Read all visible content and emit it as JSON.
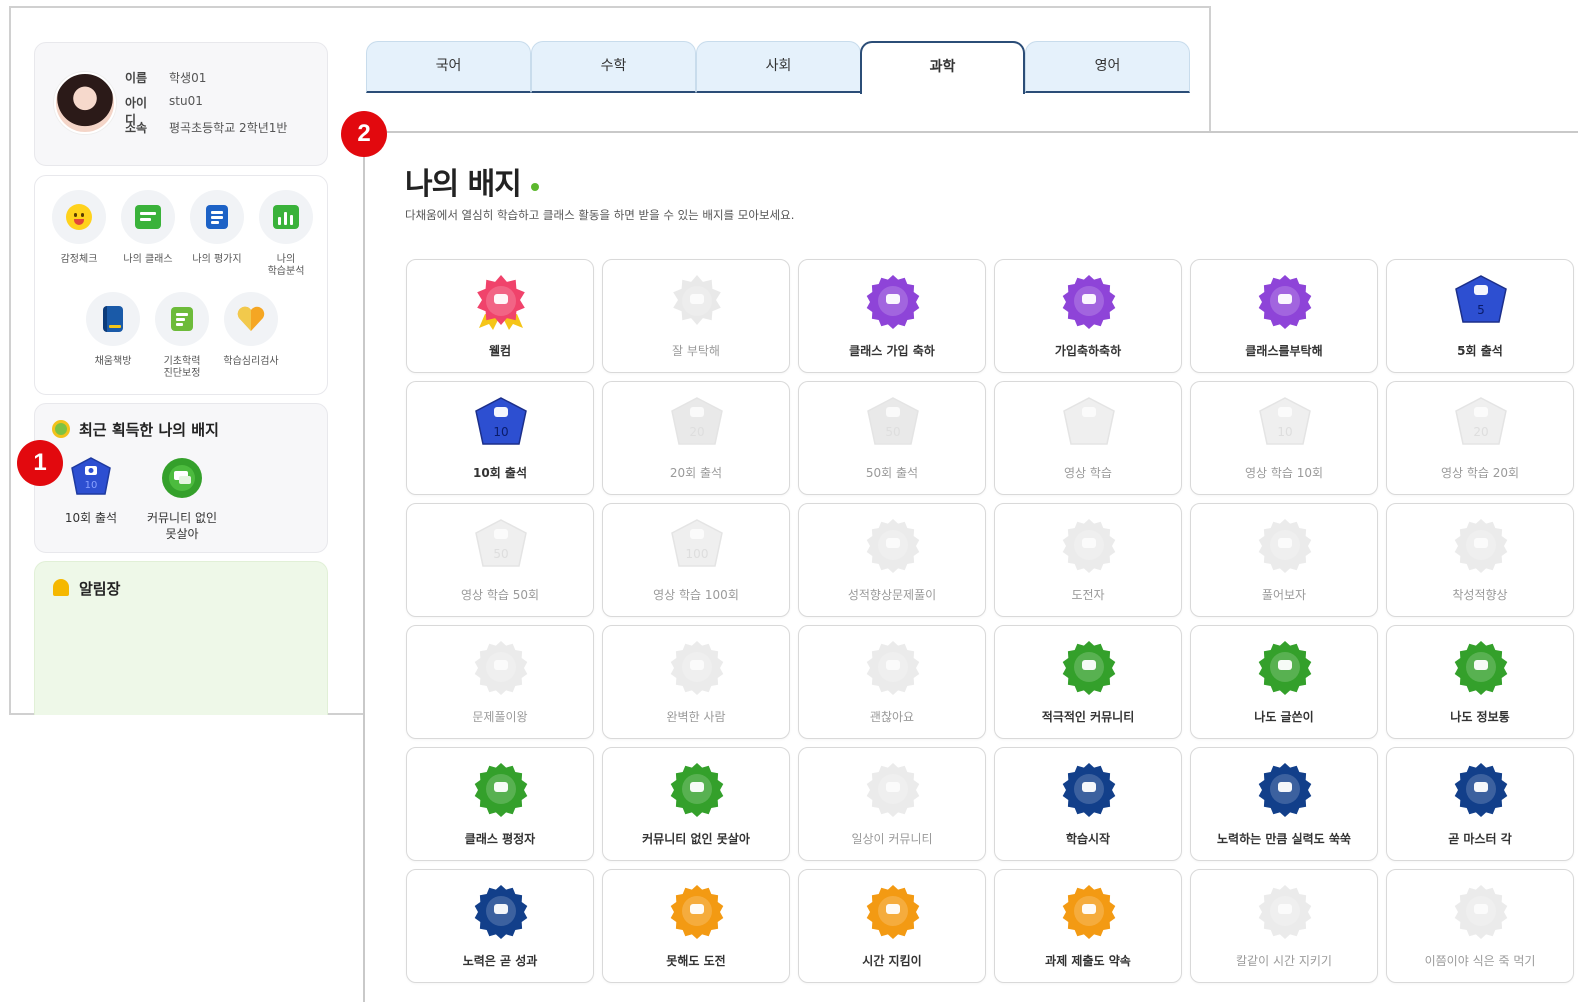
{
  "profile": {
    "name_label": "이름",
    "name_value": "학생01",
    "id_label": "아이디",
    "id_value": "stu01",
    "org_label": "소속",
    "org_value": "평곡초등학교 2학년1반"
  },
  "menu": [
    {
      "label": "감정체크",
      "icon": "face-icon",
      "color": "#ffd21c"
    },
    {
      "label": "나의 클래스",
      "icon": "class-icon",
      "color": "#3ab23a"
    },
    {
      "label": "나의 평가지",
      "icon": "document-icon",
      "color": "#1d62c6"
    },
    {
      "label": "나의\n학습분석",
      "icon": "chart-icon",
      "color": "#3ab23a"
    },
    {
      "label": "채움책방",
      "icon": "book-icon",
      "color": "#1a5aa8"
    },
    {
      "label": "기초학력\n진단보정",
      "icon": "checklist-icon",
      "color": "#6dbb3a"
    },
    {
      "label": "학습심리검사",
      "icon": "heart-icon",
      "color": "#f5a623"
    }
  ],
  "recent": {
    "title": "최근 획득한 나의 배지",
    "badges": [
      {
        "label": "10회 출석",
        "icon": "attendance-10-icon"
      },
      {
        "label": "커뮤니티 없인\n못살아",
        "icon": "community-icon"
      }
    ]
  },
  "notice": {
    "title": "알림장"
  },
  "tabs": [
    "국어",
    "수학",
    "사회",
    "과학",
    "영어"
  ],
  "active_tab": "과학",
  "markers": [
    "1",
    "2"
  ],
  "page": {
    "title": "나의 배지",
    "description": "다채움에서 열심히 학습하고 클래스 활동을 하면 받을 수 있는 배지를 모아보세요."
  },
  "badges": [
    {
      "name": "웰컴",
      "earned": true,
      "shape": "flower",
      "color": "#f0436b",
      "number": ""
    },
    {
      "name": "잘 부탁해",
      "earned": false,
      "shape": "flower",
      "color": "#d8d8d8",
      "number": ""
    },
    {
      "name": "클래스 가입 축하",
      "earned": true,
      "shape": "scallop",
      "color": "#8e44d8",
      "number": ""
    },
    {
      "name": "가입축하축하",
      "earned": true,
      "shape": "scallop",
      "color": "#8e44d8",
      "number": ""
    },
    {
      "name": "클래스를부탁해",
      "earned": true,
      "shape": "scallop",
      "color": "#8e44d8",
      "number": ""
    },
    {
      "name": "5회 출석",
      "earned": true,
      "shape": "pentagon",
      "color": "#2d4fd1",
      "number": "5"
    },
    {
      "name": "10회 출석",
      "earned": true,
      "shape": "pentagon",
      "color": "#2d4fd1",
      "number": "10"
    },
    {
      "name": "20회 출석",
      "earned": false,
      "shape": "pentagon",
      "color": "#d8d8d8",
      "number": "20"
    },
    {
      "name": "50회 출석",
      "earned": false,
      "shape": "pentagon",
      "color": "#d8d8d8",
      "number": "50"
    },
    {
      "name": "영상 학습",
      "earned": false,
      "shape": "pentagon",
      "color": "#e2e2e2",
      "number": ""
    },
    {
      "name": "영상 학습 10회",
      "earned": false,
      "shape": "pentagon",
      "color": "#e2e2e2",
      "number": "10"
    },
    {
      "name": "영상 학습 20회",
      "earned": false,
      "shape": "pentagon",
      "color": "#e2e2e2",
      "number": "20"
    },
    {
      "name": "영상 학습 50회",
      "earned": false,
      "shape": "pentagon",
      "color": "#e2e2e2",
      "number": "50"
    },
    {
      "name": "영상 학습 100회",
      "earned": false,
      "shape": "pentagon",
      "color": "#e2e2e2",
      "number": "100"
    },
    {
      "name": "성적향상문제풀이",
      "earned": false,
      "shape": "scallop",
      "color": "#dcdcdc",
      "number": ""
    },
    {
      "name": "도전자",
      "earned": false,
      "shape": "scallop",
      "color": "#dcdcdc",
      "number": ""
    },
    {
      "name": "풀어보자",
      "earned": false,
      "shape": "scallop",
      "color": "#dcdcdc",
      "number": ""
    },
    {
      "name": "착성적향상",
      "earned": false,
      "shape": "scallop",
      "color": "#dcdcdc",
      "number": ""
    },
    {
      "name": "문제풀이왕",
      "earned": false,
      "shape": "scallop",
      "color": "#dcdcdc",
      "number": ""
    },
    {
      "name": "완벽한 사람",
      "earned": false,
      "shape": "scallop",
      "color": "#dcdcdc",
      "number": ""
    },
    {
      "name": "괜찮아요",
      "earned": false,
      "shape": "scallop",
      "color": "#dcdcdc",
      "number": ""
    },
    {
      "name": "적극적인 커뮤니티",
      "earned": true,
      "shape": "scallop",
      "color": "#34a02b",
      "number": ""
    },
    {
      "name": "나도 글쓴이",
      "earned": true,
      "shape": "scallop",
      "color": "#34a02b",
      "number": ""
    },
    {
      "name": "나도 정보통",
      "earned": true,
      "shape": "scallop",
      "color": "#34a02b",
      "number": ""
    },
    {
      "name": "클래스 평정자",
      "earned": true,
      "shape": "scallop",
      "color": "#34a02b",
      "number": ""
    },
    {
      "name": "커뮤니티 없인 못살아",
      "earned": true,
      "shape": "scallop",
      "color": "#34a02b",
      "number": ""
    },
    {
      "name": "일상이 커뮤니티",
      "earned": false,
      "shape": "scallop",
      "color": "#dcdcdc",
      "number": ""
    },
    {
      "name": "학습시작",
      "earned": true,
      "shape": "scallop",
      "color": "#123f8a",
      "number": ""
    },
    {
      "name": "노력하는 만큼 실력도 쑥쑥",
      "earned": true,
      "shape": "scallop",
      "color": "#123f8a",
      "number": ""
    },
    {
      "name": "곧 마스터 각",
      "earned": true,
      "shape": "scallop",
      "color": "#123f8a",
      "number": ""
    },
    {
      "name": "노력은 곧 성과",
      "earned": true,
      "shape": "scallop",
      "color": "#123f8a",
      "number": ""
    },
    {
      "name": "못해도 도전",
      "earned": true,
      "shape": "scallop",
      "color": "#f39a13",
      "number": ""
    },
    {
      "name": "시간 지킴이",
      "earned": true,
      "shape": "scallop",
      "color": "#f39a13",
      "number": ""
    },
    {
      "name": "과제 제출도 약속",
      "earned": true,
      "shape": "scallop",
      "color": "#f39a13",
      "number": ""
    },
    {
      "name": "칼같이 시간 지키기",
      "earned": false,
      "shape": "scallop",
      "color": "#dcdcdc",
      "number": ""
    },
    {
      "name": "이쯤이야 식은 죽 먹기",
      "earned": false,
      "shape": "scallop",
      "color": "#dcdcdc",
      "number": ""
    }
  ]
}
